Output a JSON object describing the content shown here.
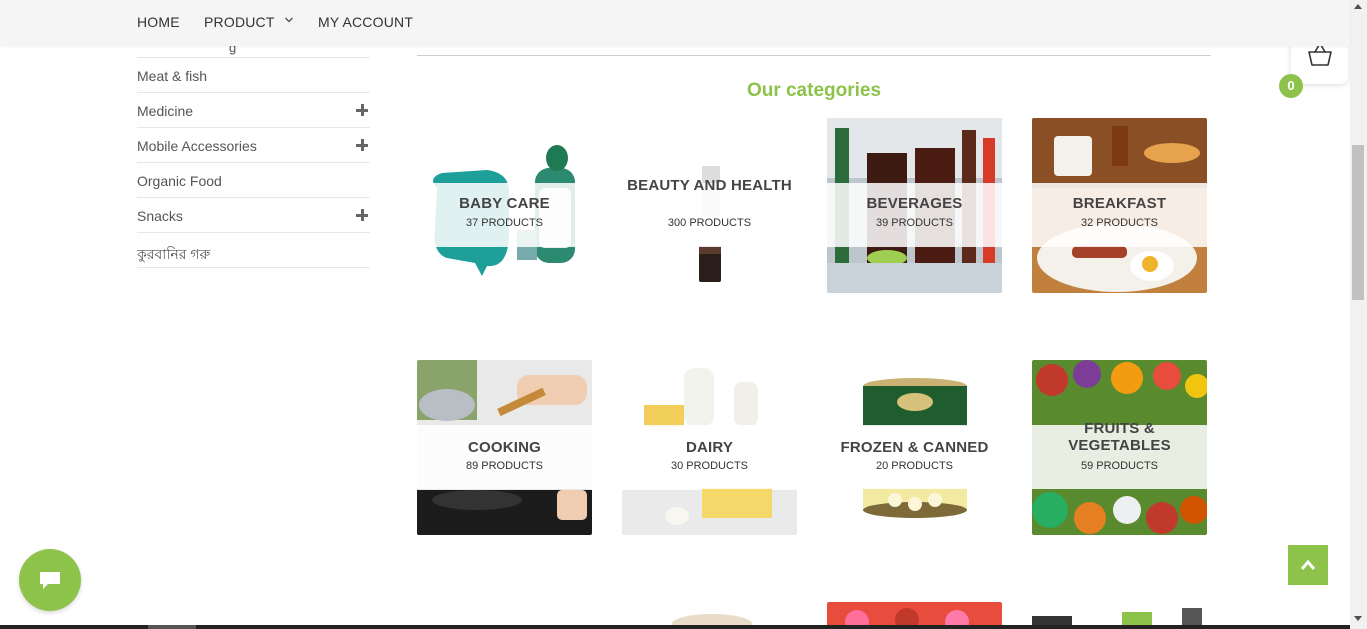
{
  "nav": {
    "items": [
      {
        "label": "HOME"
      },
      {
        "label": "PRODUCT"
      },
      {
        "label": "MY ACCOUNT"
      }
    ]
  },
  "sidebar": {
    "items": [
      {
        "label": "Meat & fish",
        "expandable": false
      },
      {
        "label": "Medicine",
        "expandable": true
      },
      {
        "label": "Mobile Accessories",
        "expandable": true
      },
      {
        "label": "Organic Food",
        "expandable": false
      },
      {
        "label": "Snacks",
        "expandable": true
      },
      {
        "label": "কুরবানির গরু",
        "expandable": false
      }
    ]
  },
  "main": {
    "section_title": "Our categories",
    "categories": [
      {
        "name": "BABY CARE",
        "count": "37 PRODUCTS"
      },
      {
        "name": "BEAUTY AND HEALTH",
        "count": "300 PRODUCTS"
      },
      {
        "name": "BEVERAGES",
        "count": "39 PRODUCTS"
      },
      {
        "name": "BREAKFAST",
        "count": "32 PRODUCTS"
      },
      {
        "name": "COOKING",
        "count": "89 PRODUCTS"
      },
      {
        "name": "DAIRY",
        "count": "30 PRODUCTS"
      },
      {
        "name": "FROZEN & CANNED",
        "count": "20 PRODUCTS"
      },
      {
        "name": "FRUITS & VEGETABLES",
        "count": "59 PRODUCTS"
      }
    ]
  },
  "cart": {
    "count": "0"
  },
  "colors": {
    "accent": "#8dc34a",
    "text": "#333333",
    "nav_bg": "#f5f5f5"
  },
  "icons": [
    "chevron-down-icon",
    "plus-icon",
    "basket-icon",
    "arrow-up-icon",
    "chat-icon"
  ]
}
